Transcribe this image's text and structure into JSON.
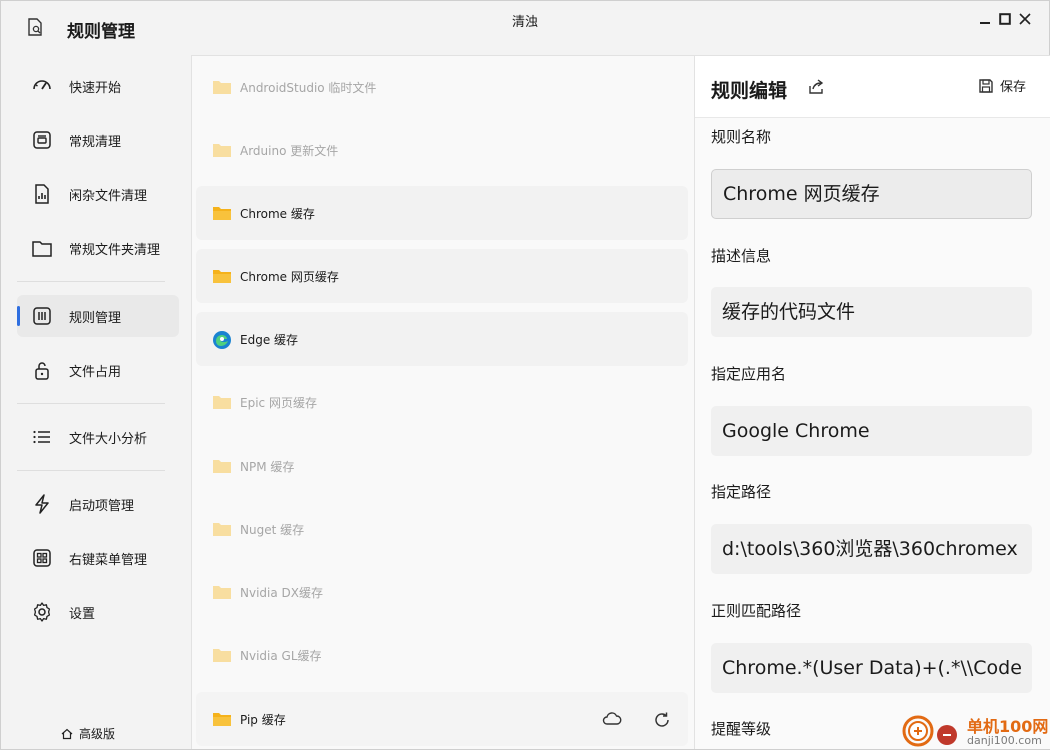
{
  "app": {
    "title": "规则管理",
    "window_title": "清浊"
  },
  "sidebar": {
    "items": [
      {
        "label": "快速开始",
        "icon": "speedometer-icon",
        "active": false
      },
      {
        "label": "常规清理",
        "icon": "cleaning-icon",
        "active": false
      },
      {
        "label": "闲杂文件清理",
        "icon": "file-chart-icon",
        "active": false
      },
      {
        "label": "常规文件夹清理",
        "icon": "folder-icon",
        "active": false
      },
      {
        "label": "规则管理",
        "icon": "rules-icon",
        "active": true
      },
      {
        "label": "文件占用",
        "icon": "unlock-icon",
        "active": false
      },
      {
        "label": "文件大小分析",
        "icon": "list-icon",
        "active": false
      },
      {
        "label": "启动项管理",
        "icon": "lightning-icon",
        "active": false
      },
      {
        "label": "右键菜单管理",
        "icon": "grid-icon",
        "active": false
      },
      {
        "label": "设置",
        "icon": "gear-icon",
        "active": false
      }
    ],
    "premium_label": "高级版"
  },
  "rules": [
    {
      "label": "AndroidStudio 临时文件",
      "enabled": false,
      "icon": "folder-icon"
    },
    {
      "label": "Arduino 更新文件",
      "enabled": false,
      "icon": "folder-icon"
    },
    {
      "label": "Chrome 缓存",
      "enabled": true,
      "icon": "folder-icon"
    },
    {
      "label": "Chrome 网页缓存",
      "enabled": true,
      "icon": "folder-icon"
    },
    {
      "label": "Edge 缓存",
      "enabled": true,
      "icon": "edge-icon"
    },
    {
      "label": "Epic 网页缓存",
      "enabled": false,
      "icon": "folder-icon"
    },
    {
      "label": "NPM 缓存",
      "enabled": false,
      "icon": "folder-icon"
    },
    {
      "label": "Nuget 缓存",
      "enabled": false,
      "icon": "folder-icon"
    },
    {
      "label": "Nvidia DX缓存",
      "enabled": false,
      "icon": "folder-icon"
    },
    {
      "label": "Nvidia GL缓存",
      "enabled": false,
      "icon": "folder-icon"
    },
    {
      "label": "Pip 缓存",
      "enabled": true,
      "icon": "folder-icon"
    }
  ],
  "editor": {
    "title": "规则编辑",
    "save_label": "保存",
    "fields": [
      {
        "label": "规则名称",
        "value": "Chrome 网页缓存"
      },
      {
        "label": "描述信息",
        "value": "缓存的代码文件"
      },
      {
        "label": "指定应用名",
        "value": "Google Chrome"
      },
      {
        "label": "指定路径",
        "value": "d:\\tools\\360浏览器\\360chromex"
      },
      {
        "label": "正则匹配路径",
        "value": "Chrome.*(User Data)+(.*\\\\Code"
      },
      {
        "label": "提醒等级",
        "value": ""
      }
    ]
  },
  "watermark": {
    "line1": "单机100网",
    "line2": "danji100.com"
  },
  "colors": {
    "accent": "#2f6fe0",
    "folder": "#f5b21b",
    "folder_disabled": "#f8dea0"
  }
}
